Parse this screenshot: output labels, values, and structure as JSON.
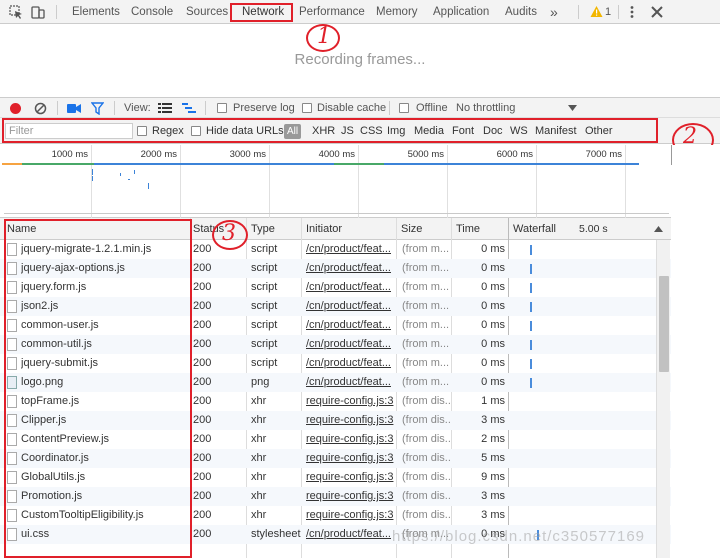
{
  "tabs": [
    "Elements",
    "Console",
    "Sources",
    "Network",
    "Performance",
    "Memory",
    "Application",
    "Audits"
  ],
  "tabs_more": "»",
  "warning_count": "1",
  "recording_text": "Recording frames...",
  "toolbar": {
    "view_label": "View:",
    "preserve_log": "Preserve log",
    "disable_cache": "Disable cache",
    "offline": "Offline",
    "throttling": "No throttling"
  },
  "filter": {
    "placeholder": "Filter",
    "regex": "Regex",
    "hide_data_urls": "Hide data URLs",
    "types": [
      "All",
      "XHR",
      "JS",
      "CSS",
      "Img",
      "Media",
      "Font",
      "Doc",
      "WS",
      "Manifest",
      "Other"
    ]
  },
  "overview_ticks": [
    "1000 ms",
    "2000 ms",
    "3000 ms",
    "4000 ms",
    "5000 ms",
    "6000 ms",
    "7000 ms"
  ],
  "columns": {
    "name": "Name",
    "status": "Status",
    "type": "Type",
    "initiator": "Initiator",
    "size": "Size",
    "time": "Time",
    "waterfall": "Waterfall",
    "waterfall_time": "5.00 s"
  },
  "rows": [
    {
      "name": "jquery-migrate-1.2.1.min.js",
      "status": "200",
      "type": "script",
      "initiator": "/cn/product/feat...",
      "size": "(from m...",
      "time": "0 ms"
    },
    {
      "name": "jquery-ajax-options.js",
      "status": "200",
      "type": "script",
      "initiator": "/cn/product/feat...",
      "size": "(from m...",
      "time": "0 ms"
    },
    {
      "name": "jquery.form.js",
      "status": "200",
      "type": "script",
      "initiator": "/cn/product/feat...",
      "size": "(from m...",
      "time": "0 ms"
    },
    {
      "name": "json2.js",
      "status": "200",
      "type": "script",
      "initiator": "/cn/product/feat...",
      "size": "(from m...",
      "time": "0 ms"
    },
    {
      "name": "common-user.js",
      "status": "200",
      "type": "script",
      "initiator": "/cn/product/feat...",
      "size": "(from m...",
      "time": "0 ms"
    },
    {
      "name": "common-util.js",
      "status": "200",
      "type": "script",
      "initiator": "/cn/product/feat...",
      "size": "(from m...",
      "time": "0 ms"
    },
    {
      "name": "jquery-submit.js",
      "status": "200",
      "type": "script",
      "initiator": "/cn/product/feat...",
      "size": "(from m...",
      "time": "0 ms"
    },
    {
      "name": "logo.png",
      "status": "200",
      "type": "png",
      "initiator": "/cn/product/feat...",
      "size": "(from m...",
      "time": "0 ms"
    },
    {
      "name": "topFrame.js",
      "status": "200",
      "type": "xhr",
      "initiator": "require-config.js:3",
      "size": "(from dis...",
      "time": "1 ms"
    },
    {
      "name": "Clipper.js",
      "status": "200",
      "type": "xhr",
      "initiator": "require-config.js:3",
      "size": "(from dis...",
      "time": "3 ms"
    },
    {
      "name": "ContentPreview.js",
      "status": "200",
      "type": "xhr",
      "initiator": "require-config.js:3",
      "size": "(from dis...",
      "time": "2 ms"
    },
    {
      "name": "Coordinator.js",
      "status": "200",
      "type": "xhr",
      "initiator": "require-config.js:3",
      "size": "(from dis...",
      "time": "5 ms"
    },
    {
      "name": "GlobalUtils.js",
      "status": "200",
      "type": "xhr",
      "initiator": "require-config.js:3",
      "size": "(from dis...",
      "time": "9 ms"
    },
    {
      "name": "Promotion.js",
      "status": "200",
      "type": "xhr",
      "initiator": "require-config.js:3",
      "size": "(from dis...",
      "time": "3 ms"
    },
    {
      "name": "CustomTooltipEligibility.js",
      "status": "200",
      "type": "xhr",
      "initiator": "require-config.js:3",
      "size": "(from dis...",
      "time": "3 ms"
    },
    {
      "name": "ui.css",
      "status": "200",
      "type": "stylesheet",
      "initiator": "/cn/product/feat...",
      "size": "(from m...",
      "time": "0 ms"
    }
  ],
  "annotations": [
    "1",
    "2",
    "3"
  ],
  "watermark": "https://blog.csdn.net/c350577169",
  "colors": {
    "accent": "#1a73e8",
    "record": "#e0202a",
    "annotation": "#e0202a"
  }
}
